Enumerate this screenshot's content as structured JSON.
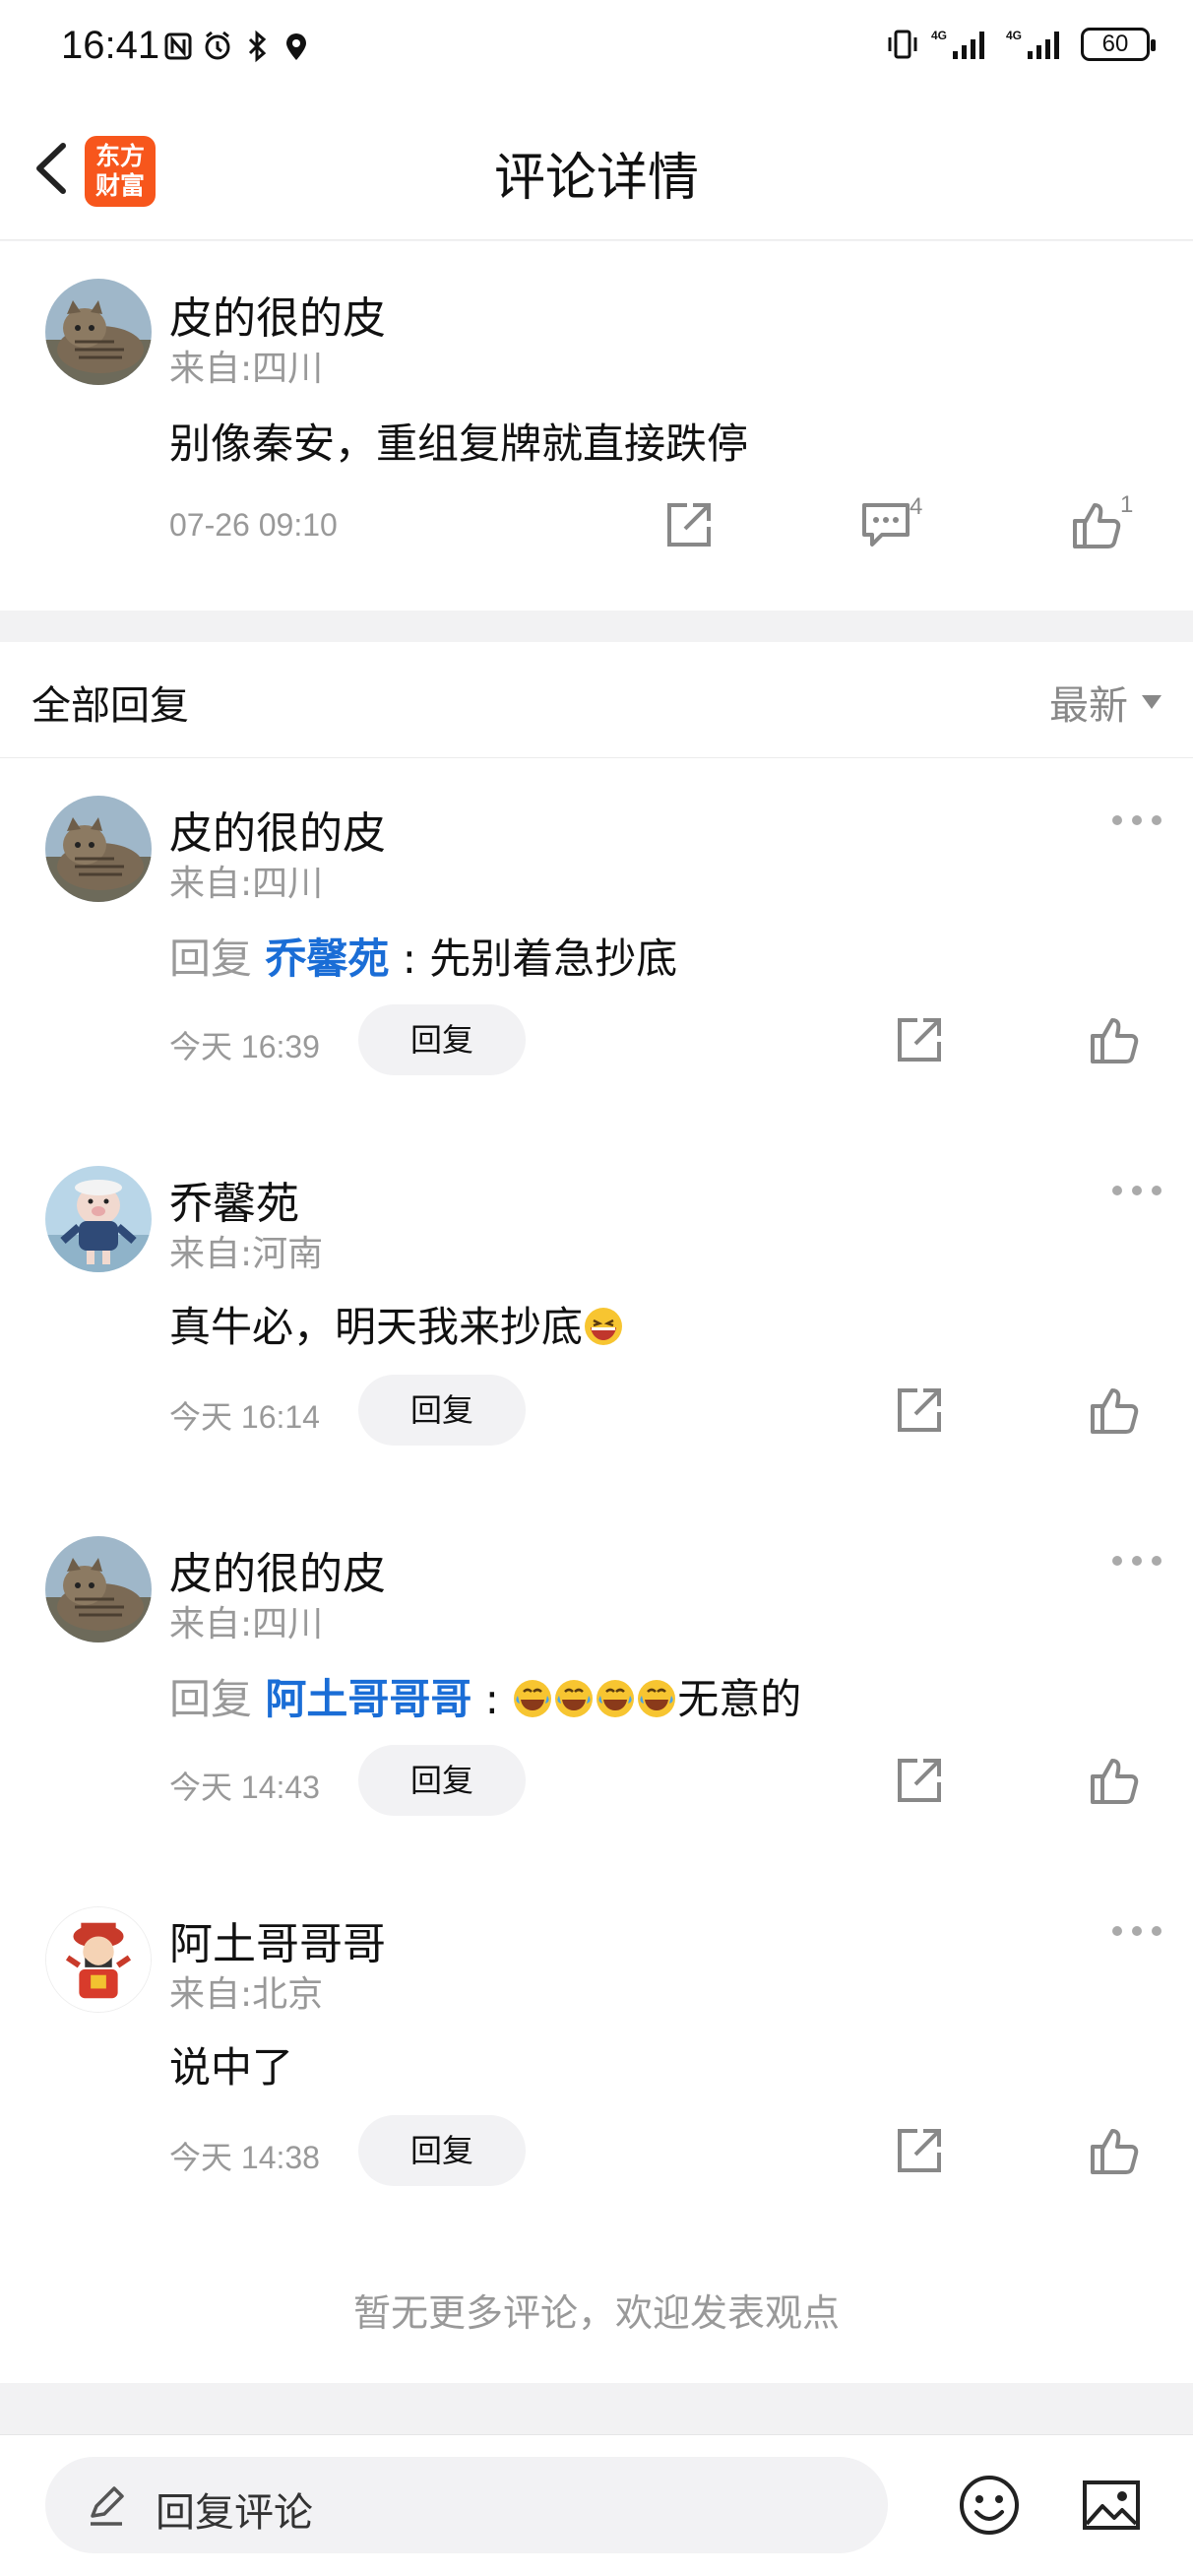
{
  "status_bar": {
    "time": "16:41",
    "battery": "60",
    "network_1": "4G",
    "network_2": "4G"
  },
  "nav": {
    "title": "评论详情",
    "logo_line1": "东方",
    "logo_line2": "财富",
    "brand_color": "#f7561c"
  },
  "main_comment": {
    "username": "皮的很的皮",
    "location": "来自:四川",
    "content": "别像秦安，重组复牌就直接跌停",
    "timestamp": "07-26 09:10",
    "comment_count": "4",
    "like_count": "1"
  },
  "replies_header": {
    "title": "全部回复",
    "sort": "最新"
  },
  "replies": [
    {
      "username": "皮的很的皮",
      "location": "来自:四川",
      "prefix": "回复",
      "mention": "乔馨苑",
      "separator": ":",
      "content": "先别着急抄底",
      "timestamp": "今天 16:39",
      "reply_label": "回复"
    },
    {
      "username": "乔馨苑",
      "location": "来自:河南",
      "content": "真牛必，明天我来抄底",
      "timestamp": "今天 16:14",
      "reply_label": "回复"
    },
    {
      "username": "皮的很的皮",
      "location": "来自:四川",
      "prefix": "回复",
      "mention": "阿土哥哥哥",
      "separator": ":",
      "content": "无意的",
      "timestamp": "今天 14:43",
      "reply_label": "回复"
    },
    {
      "username": "阿土哥哥哥",
      "location": "来自:北京",
      "content": "说中了",
      "timestamp": "今天 14:38",
      "reply_label": "回复"
    }
  ],
  "footer_note": "暂无更多评论，欢迎发表观点",
  "bottom_bar": {
    "input_placeholder": "回复评论"
  },
  "colors": {
    "mention": "#1a6dd6",
    "muted": "#999999"
  }
}
